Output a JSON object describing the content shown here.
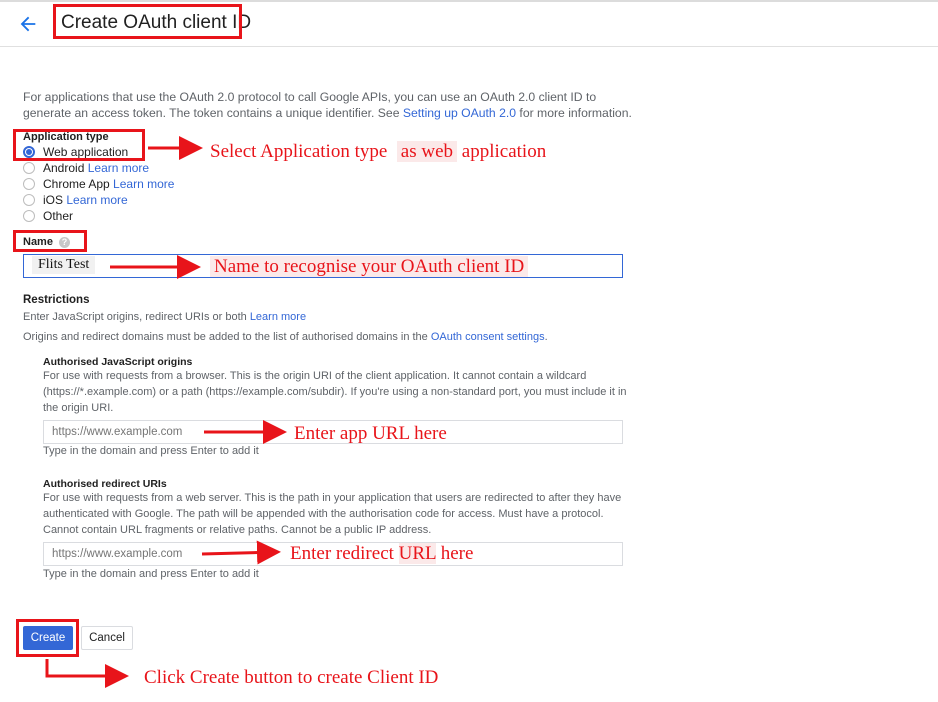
{
  "header": {
    "title": "Create OAuth client ID"
  },
  "intro": {
    "text_before": "For applications that use the OAuth 2.0 protocol to call Google APIs, you can use an OAuth 2.0 client ID to generate an access token. The token contains a unique identifier. See ",
    "link": "Setting up OAuth 2.0",
    "text_after": " for more information."
  },
  "application_type": {
    "label": "Application type",
    "selected": "Web application",
    "options": [
      {
        "label": "Web application",
        "link": ""
      },
      {
        "label": "Android",
        "link": "Learn more"
      },
      {
        "label": "Chrome App",
        "link": "Learn more"
      },
      {
        "label": "iOS",
        "link": "Learn more"
      },
      {
        "label": "Other",
        "link": ""
      }
    ]
  },
  "name": {
    "label": "Name",
    "help": "?",
    "value": "Flits Test"
  },
  "restrictions": {
    "title": "Restrictions",
    "line1_text": "Enter JavaScript origins, redirect URIs or both ",
    "line1_link": "Learn more",
    "line2_text": "Origins and redirect domains must be added to the list of authorised domains in the ",
    "line2_link": "OAuth consent settings",
    "line2_end": ".",
    "js_origins": {
      "title": "Authorised JavaScript origins",
      "desc": "For use with requests from a browser. This is the origin URI of the client application. It cannot contain a wildcard (https://*.example.com) or a path (https://example.com/subdir). If you're using a non-standard port, you must include it in the origin URI.",
      "placeholder": "https://www.example.com",
      "hint": "Type in the domain and press Enter to add it"
    },
    "redirect_uris": {
      "title": "Authorised redirect URIs",
      "desc": "For use with requests from a web server. This is the path in your application that users are redirected to after they have authenticated with Google. The path will be appended with the authorisation code for access. Must have a protocol. Cannot contain URL fragments or relative paths. Cannot be a public IP address.",
      "placeholder": "https://www.example.com",
      "hint": "Type in the domain and press Enter to add it"
    }
  },
  "buttons": {
    "create": "Create",
    "cancel": "Cancel"
  },
  "annotations": {
    "app_type_a": "Select Application type",
    "app_type_b": "as web",
    "app_type_c": "application",
    "name": "Name to recognise your OAuth client ID",
    "app_url": "Enter app URL here",
    "redirect_a": "Enter redirect ",
    "redirect_b": "URL",
    "redirect_c": " here",
    "create": "Click Create button to create Client ID"
  },
  "colors": {
    "accent": "#3367d6",
    "annotation_red": "#e8141a"
  },
  "icons": {
    "back": "arrow-left-icon",
    "help": "help-icon"
  }
}
